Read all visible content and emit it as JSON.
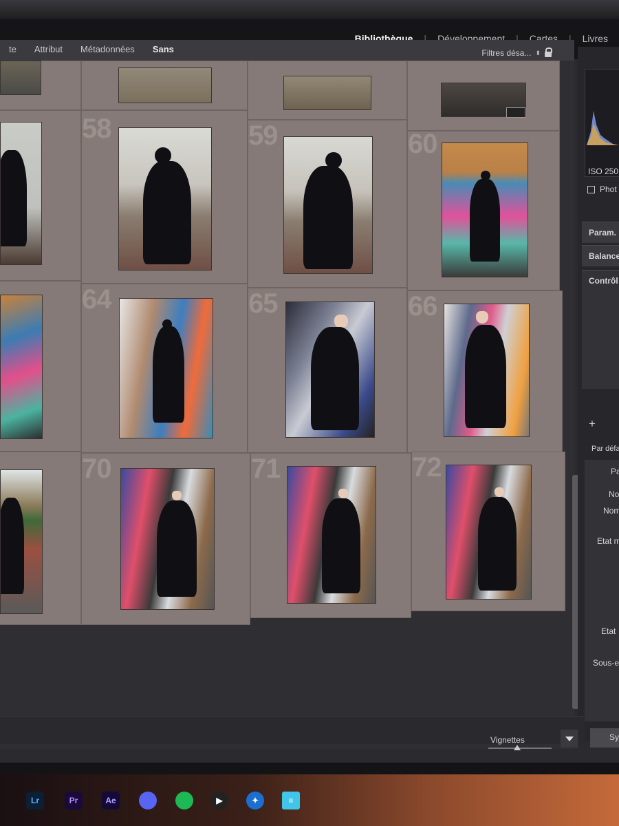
{
  "modules": [
    {
      "label": "Bibliothèque",
      "active": true
    },
    {
      "label": "Développement",
      "active": false
    },
    {
      "label": "Cartes",
      "active": false
    },
    {
      "label": "Livres",
      "active": false
    }
  ],
  "filter_tabs": [
    {
      "label": "te",
      "active": false
    },
    {
      "label": "Attribut",
      "active": false
    },
    {
      "label": "Métadonnées",
      "active": false
    },
    {
      "label": "Sans",
      "active": true
    }
  ],
  "filters_status": "Filtres désa...",
  "grid_numbers": [
    "58",
    "59",
    "60",
    "64",
    "65",
    "66",
    "70",
    "71",
    "72"
  ],
  "right_panel": {
    "iso": "ISO 250",
    "photo_label": "Phot",
    "sections": [
      "Param.",
      "Balance",
      "Contrôl"
    ],
    "plus": "+",
    "preset": "Par défa",
    "fields": [
      "Pa",
      "No",
      "Nom",
      "Etat m",
      "Etat",
      "Sous-e"
    ],
    "sync": "Sy"
  },
  "toolbar": {
    "thumbnails_label": "Vignettes"
  },
  "taskbar": [
    {
      "label": "Lr",
      "name": "lightroom-icon"
    },
    {
      "label": "Pr",
      "name": "premiere-icon"
    },
    {
      "label": "Ae",
      "name": "after-effects-icon"
    },
    {
      "label": "",
      "name": "discord-icon"
    },
    {
      "label": "",
      "name": "spotify-icon"
    },
    {
      "label": "",
      "name": "media-player-icon"
    },
    {
      "label": "",
      "name": "app-icon"
    },
    {
      "label": "",
      "name": "notepad-icon"
    }
  ]
}
